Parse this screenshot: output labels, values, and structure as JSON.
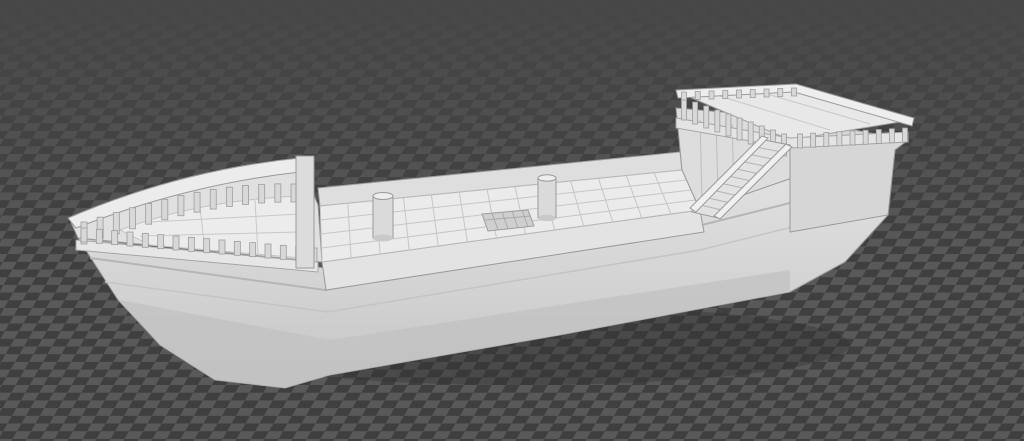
{
  "viewport": {
    "background_color": "#4a4a4a",
    "checker_dark": "#3f3f3f",
    "checker_light": "#595959",
    "horizon_color": "#474747"
  },
  "model": {
    "name": "",
    "hull_color": "#d8d8d8",
    "hull_shadow_color": "#b9b9b9",
    "deck_color": "#e6e6e6",
    "deck_line_color": "#bdbdbd",
    "railing_color": "#e2e2e2",
    "outline_color": "#9a9a9a",
    "icon": "ship-model-icon"
  }
}
